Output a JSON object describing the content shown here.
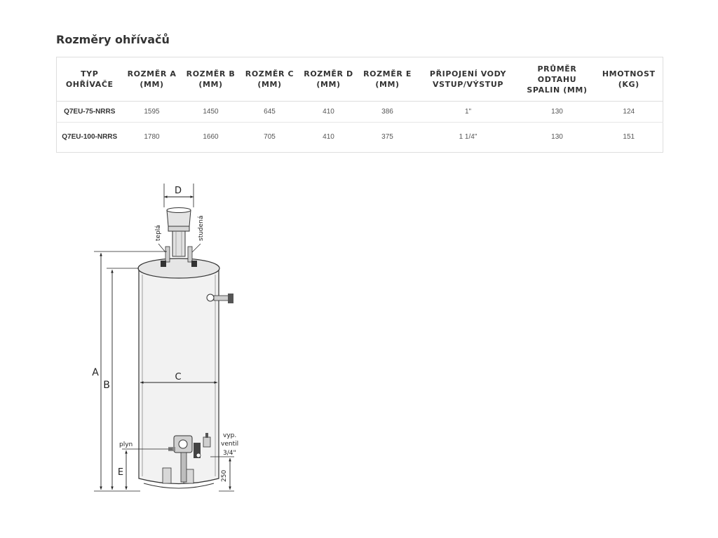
{
  "section_title": "Rozměry ohřívačů",
  "table": {
    "headers": [
      "TYP OHŘÍVAČE",
      "ROZMĚR A (MM)",
      "ROZMĚR B (MM)",
      "ROZMĚR C (MM)",
      "ROZMĚR D (MM)",
      "ROZMĚR E (MM)",
      "PŘIPOJENÍ VODY VSTUP/VÝSTUP",
      "PRŮMĚR ODTAHU SPALIN (MM)",
      "HMOTNOST (KG)"
    ],
    "rows": [
      [
        "Q7EU-75-NRRS",
        "1595",
        "1450",
        "645",
        "410",
        "386",
        "1\"",
        "130",
        "124"
      ],
      [
        "Q7EU-100-NRRS",
        "1780",
        "1660",
        "705",
        "410",
        "375",
        "1 1/4\"",
        "130",
        "151"
      ]
    ]
  },
  "diagram": {
    "label_a": "A",
    "label_b": "B",
    "label_c": "C",
    "label_d": "D",
    "label_e": "E",
    "label_hot": "teplá",
    "label_cold": "studená",
    "label_gas": "plyn",
    "label_drain_1": "vyp.",
    "label_drain_2": "ventil",
    "label_drain_3": "3/4\"",
    "label_250": "250"
  }
}
